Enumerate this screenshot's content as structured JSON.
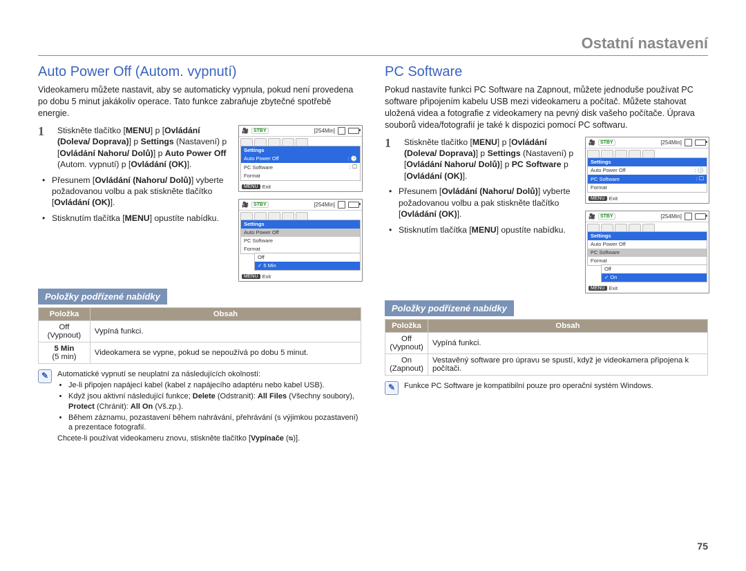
{
  "header": {
    "title": "Ostatní nastavení"
  },
  "page_number": "75",
  "left": {
    "heading": "Auto Power Off (Autom. vypnutí)",
    "intro": "Videokameru můžete nastavit, aby se automaticky vypnula, pokud není provedena po dobu 5 minut jakákoliv operace. Tato funkce zabraňuje zbytečné spotřebě energie.",
    "steps": {
      "s1_a": "Stiskněte tlačítko [",
      "s1_b": "MENU",
      "s1_c": "]  p [",
      "s1_d": "Ovládání (Doleva/ Doprava)",
      "s1_e": "]  p ",
      "s1_f": "Settings",
      "s1_g": " (Nastavení)  p [",
      "s1_h": "Ovládání Nahoru/ Dolů)",
      "s1_i": "]  p ",
      "s1_j": "Auto Power Off",
      "s1_k": " (Autom. vypnutí)  p [",
      "s1_l": "Ovládání (OK)",
      "s1_m": "].",
      "b1": "Přesunem [",
      "b1b": "Ovládání (Nahoru/ Dolů)",
      "b1c": "] vyberte požadovanou volbu a pak stiskněte tlačítko [",
      "b1d": "Ovládání (OK)",
      "b1e": "].",
      "b2a": "Stisknutím tlačítka [",
      "b2b": "MENU",
      "b2c": "] opustíte nabídku."
    },
    "screens": {
      "common": {
        "stby": "STBY",
        "time": "[254Min]",
        "exit": "Exit",
        "menu": "MENU",
        "settings": "Settings"
      },
      "s1": {
        "rows": [
          "Auto Power Off",
          "PC Software",
          "Format"
        ],
        "sel": "Auto Power Off"
      },
      "s2": {
        "rows": [
          "Auto Power Off",
          "PC Software",
          "Format"
        ],
        "selgray": "Auto Power Off",
        "sub": [
          "Off",
          "5 Min"
        ],
        "subsel": "5 Min",
        "check": "✓"
      }
    },
    "subheading": "Položky podřízené nabídky",
    "table": {
      "h1": "Položka",
      "h2": "Obsah",
      "r1c1a": "Off",
      "r1c1b": "(Vypnout)",
      "r1c2": "Vypíná funkci.",
      "r2c1a": "5 Min",
      "r2c1b": "(5 min)",
      "r2c2": "Videokamera se vypne, pokud se nepoužívá po dobu 5 minut."
    },
    "note": {
      "lead": "Automatické vypnutí se neuplatní za následujících okolností:",
      "li1": "Je-li připojen napájecí kabel (kabel z napájecího adaptéru nebo kabel USB).",
      "li2a": "Když jsou aktivní následující funkce; ",
      "li2b": "Delete",
      "li2c": " (Odstranit): ",
      "li2d": "All Files",
      "li2e": " (Všechny soubory), ",
      "li2f": "Protect",
      "li2g": " (Chránit): ",
      "li2h": "All On",
      "li2i": " (Vš.zp.).",
      "li3": "Během záznamu, pozastavení během nahrávání, přehrávání (s výjimkou pozastavení) a prezentace fotografií.",
      "tail": "Chcete-li používat videokameru znovu, stiskněte tlačítko [",
      "tailb": "Vypínače",
      "tailc": " (ᴓ)]."
    }
  },
  "right": {
    "heading": "PC Software",
    "intro": "Pokud nastavíte funkci PC Software na Zapnout, můžete jednoduše používat PC software připojením kabelu USB mezi videokameru a počítač. Můžete stahovat uložená videa a fotografie z videokamery na pevný disk vašeho počítače. Úprava souborů videa/fotografií je také k dispozici pomocí PC softwaru.",
    "steps": {
      "s1_a": "Stiskněte tlačítko [",
      "s1_b": "MENU",
      "s1_c": "]  p [",
      "s1_d": "Ovládání (Doleva/ Doprava)",
      "s1_e": "]  p ",
      "s1_f": "Settings",
      "s1_g": " (Nastavení)  p [",
      "s1_h": "Ovládání Nahoru/ Dolů)",
      "s1_i": "]  p ",
      "s1_j": "PC Software",
      "s1_k": "  p [",
      "s1_l": "Ovládání (OK)",
      "s1_m": "].",
      "b1": "Přesunem [",
      "b1b": "Ovládání (Nahoru/ Dolů)",
      "b1c": "] vyberte požadovanou volbu a pak stiskněte tlačítko [",
      "b1d": "Ovládání (OK)",
      "b1e": "].",
      "b2a": "Stisknutím tlačítka [",
      "b2b": "MENU",
      "b2c": "] opustíte nabídku."
    },
    "screens": {
      "common": {
        "stby": "STBY",
        "time": "[254Min]",
        "exit": "Exit",
        "menu": "MENU",
        "settings": "Settings"
      },
      "s1": {
        "rows": [
          "Auto Power Off",
          "PC Software",
          "Format"
        ],
        "sel": "PC Software"
      },
      "s2": {
        "rows": [
          "Auto Power Off",
          "PC Software",
          "Format"
        ],
        "selgray": "PC Software",
        "sub": [
          "Off",
          "On"
        ],
        "subsel": "On",
        "check": "✓"
      }
    },
    "subheading": "Položky podřízené nabídky",
    "table": {
      "h1": "Položka",
      "h2": "Obsah",
      "r1c1a": "Off",
      "r1c1b": "(Vypnout)",
      "r1c2": "Vypíná funkci.",
      "r2c1a": "On",
      "r2c1b": "(Zapnout)",
      "r2c2": "Vestavěný software pro úpravu se spustí, když je videokamera připojena k počítači."
    },
    "note": {
      "text": "Funkce PC Software je kompatibilní pouze pro operační systém Windows."
    }
  }
}
